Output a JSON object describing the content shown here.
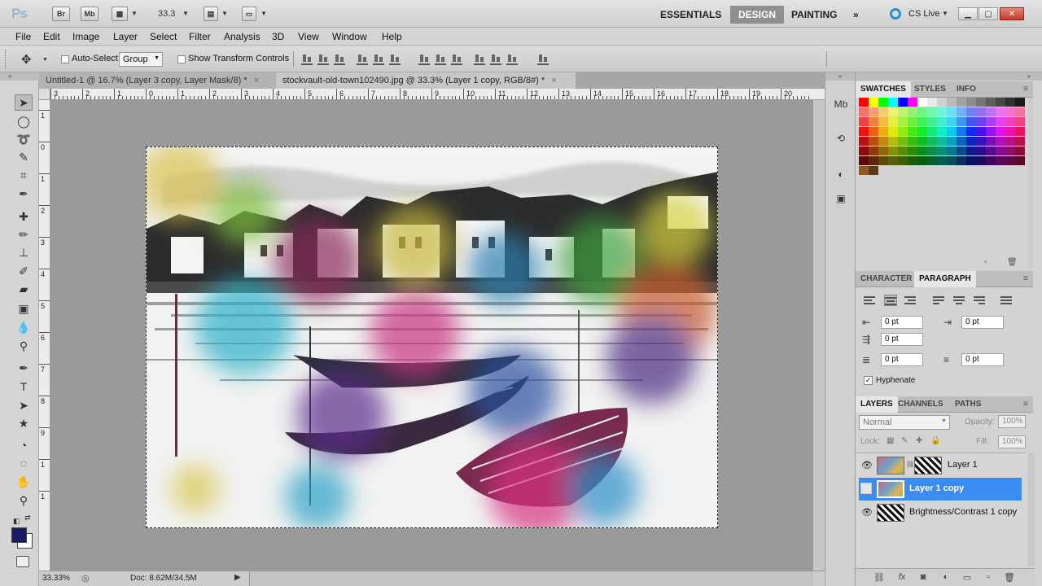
{
  "titlebar": {
    "app_logo": "Ps",
    "bridge_label": "Br",
    "minibridge_label": "Mb",
    "zoom_value": "33.3",
    "workspaces": [
      "ESSENTIALS",
      "DESIGN",
      "PAINTING"
    ],
    "active_workspace": "DESIGN",
    "more_label": "»",
    "cslive_label": "CS Live"
  },
  "menus": [
    "File",
    "Edit",
    "Image",
    "Layer",
    "Select",
    "Filter",
    "Analysis",
    "3D",
    "View",
    "Window",
    "Help"
  ],
  "options": {
    "auto_select_label": "Auto-Select:",
    "auto_select_value": "Group",
    "transform_label": "Show Transform Controls"
  },
  "documents": [
    {
      "label": "Untitled-1 @ 16.7% (Layer 3 copy, Layer Mask/8) *",
      "active": false
    },
    {
      "label": "stockvault-old-town102490.jpg @ 33.3% (Layer 1 copy, RGB/8#) *",
      "active": true
    }
  ],
  "ruler": {
    "h_ticks": [
      "3",
      "2",
      "1",
      "0",
      "1",
      "2",
      "3",
      "4",
      "5",
      "6",
      "7",
      "8",
      "9",
      "10",
      "11",
      "12",
      "13",
      "14",
      "15",
      "16",
      "17",
      "18",
      "19",
      "20"
    ],
    "v_ticks": [
      "1",
      "0",
      "1",
      "2",
      "3",
      "4",
      "5",
      "6",
      "7",
      "8",
      "9",
      "1",
      "1"
    ]
  },
  "status": {
    "zoom": "33.33%",
    "doc": "Doc: 8.62M/34.5M"
  },
  "swatches_panel": {
    "tabs": [
      "SWATCHES",
      "STYLES",
      "INFO"
    ],
    "active_tab": "SWATCHES"
  },
  "paragraph_panel": {
    "tabs": [
      "CHARACTER",
      "PARAGRAPH"
    ],
    "active_tab": "PARAGRAPH",
    "indent_left": "0 pt",
    "indent_right": "0 pt",
    "first_line": "0 pt",
    "space_before": "0 pt",
    "space_after": "0 pt",
    "hyphenate_label": "Hyphenate",
    "hyphenate_checked": true
  },
  "layers_panel": {
    "tabs": [
      "LAYERS",
      "CHANNELS",
      "PATHS"
    ],
    "active_tab": "LAYERS",
    "blend_mode": "Normal",
    "opacity_label": "Opacity:",
    "opacity_value": "100%",
    "lock_label": "Lock:",
    "fill_label": "Fill:",
    "fill_value": "100%",
    "layers": [
      {
        "name": "Layer 1",
        "visible": true,
        "selected": false,
        "has_mask": true
      },
      {
        "name": "Layer 1 copy",
        "visible": false,
        "selected": true,
        "has_mask": false
      },
      {
        "name": "Brightness/Contrast 1 copy",
        "visible": true,
        "selected": false,
        "has_mask": false
      }
    ]
  },
  "colors": {
    "foreground": "#1a1a66",
    "background": "#ffffff",
    "selection": "#3a8cf0",
    "active_workspace_bg": "#8f8f8f"
  }
}
